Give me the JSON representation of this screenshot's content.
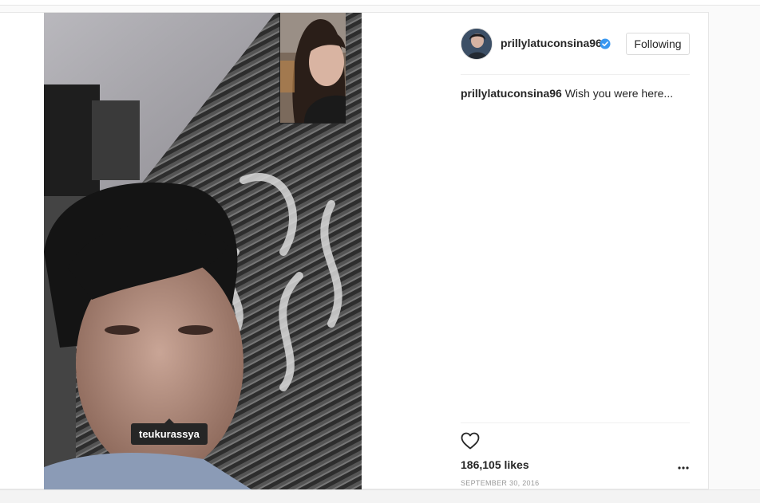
{
  "post": {
    "tagged_user": "teukurassya"
  },
  "header": {
    "username": "prillylatuconsina96",
    "follow_label": "Following"
  },
  "caption": {
    "username": "prillylatuconsina96",
    "text": "Wish you were here..."
  },
  "stats": {
    "likes": "186,105 likes",
    "date": "SEPTEMBER 30, 2016"
  },
  "icons": {
    "verified": "verified-badge-icon",
    "like": "heart-icon",
    "more": "more-options-icon"
  },
  "colors": {
    "verified_blue": "#3897f0",
    "text": "#262626",
    "muted": "#999999"
  }
}
